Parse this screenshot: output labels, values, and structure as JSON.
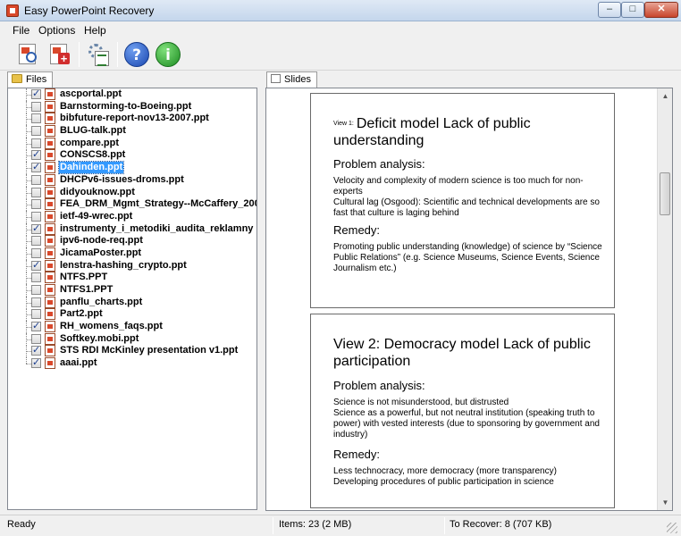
{
  "window": {
    "title": "Easy PowerPoint Recovery"
  },
  "menu": [
    "File",
    "Options",
    "Help"
  ],
  "toolbar": {
    "buttons": [
      {
        "name": "scan-file",
        "icon": "document-search-icon"
      },
      {
        "name": "add-file",
        "icon": "document-add-icon"
      },
      {
        "name": "recover",
        "icon": "gear-checklist-icon"
      },
      {
        "name": "help",
        "icon": "help-icon",
        "glyph": "?"
      },
      {
        "name": "about",
        "icon": "info-icon",
        "glyph": "i"
      }
    ]
  },
  "left_tab": {
    "label": "Files"
  },
  "right_tab": {
    "label": "Slides"
  },
  "files": [
    {
      "name": "ascportal.ppt",
      "checked": true
    },
    {
      "name": "Barnstorming-to-Boeing.ppt",
      "checked": false
    },
    {
      "name": "bibfuture-report-nov13-2007.ppt",
      "checked": false
    },
    {
      "name": "BLUG-talk.ppt",
      "checked": false
    },
    {
      "name": "compare.ppt",
      "checked": false
    },
    {
      "name": "CONSCS8.ppt",
      "checked": true
    },
    {
      "name": "Dahinden.ppt",
      "checked": true,
      "selected": true
    },
    {
      "name": "DHCPv6-issues-droms.ppt",
      "checked": false
    },
    {
      "name": "didyouknow.ppt",
      "checked": false
    },
    {
      "name": "FEA_DRM_Mgmt_Strategy--McCaffery_200",
      "checked": false
    },
    {
      "name": "ietf-49-wrec.ppt",
      "checked": false
    },
    {
      "name": "instrumenty_i_metodiki_audita_reklamny",
      "checked": true
    },
    {
      "name": "ipv6-node-req.ppt",
      "checked": false
    },
    {
      "name": "JicamaPoster.ppt",
      "checked": false
    },
    {
      "name": "lenstra-hashing_crypto.ppt",
      "checked": true
    },
    {
      "name": "NTFS.PPT",
      "checked": false
    },
    {
      "name": "NTFS1.PPT",
      "checked": false
    },
    {
      "name": "panflu_charts.ppt",
      "checked": false
    },
    {
      "name": "Part2.ppt",
      "checked": false
    },
    {
      "name": "RH_womens_faqs.ppt",
      "checked": true
    },
    {
      "name": "Softkey.mobi.ppt",
      "checked": false
    },
    {
      "name": "STS RDI McKinley presentation v1.ppt",
      "checked": true
    },
    {
      "name": "aaai.ppt",
      "checked": true
    }
  ],
  "slides": [
    {
      "title_prefix": "View 1:",
      "title": "Deficit model Lack of public understanding",
      "section1_head": "Problem analysis:",
      "section1_lines": [
        "Velocity and complexity of modern science is too much for non-experts",
        "Cultural lag (Osgood): Scientific and technical developments are so fast that culture is laging behind"
      ],
      "section2_head": "Remedy:",
      "section2_lines": [
        "Promoting public understanding (knowledge) of science by “Science Public Relations” (e.g. Science Museums, Science Events, Science Journalism etc.)"
      ]
    },
    {
      "title_prefix": "",
      "title": "View 2: Democracy model Lack of public participation",
      "section1_head": "Problem analysis:",
      "section1_lines": [
        "Science is not misunderstood, but distrusted",
        "Science as a powerful, but not neutral institution (speaking truth to power) with vested interests (due to sponsoring by government and industry)"
      ],
      "section2_head": "Remedy:",
      "section2_lines": [
        "Less technocracy, more democracy (more transparency)",
        "Developing procedures of public participation in science"
      ]
    }
  ],
  "status": {
    "ready": "Ready",
    "items": "Items: 23 (2 MB)",
    "to_recover": "To Recover: 8 (707 KB)"
  }
}
